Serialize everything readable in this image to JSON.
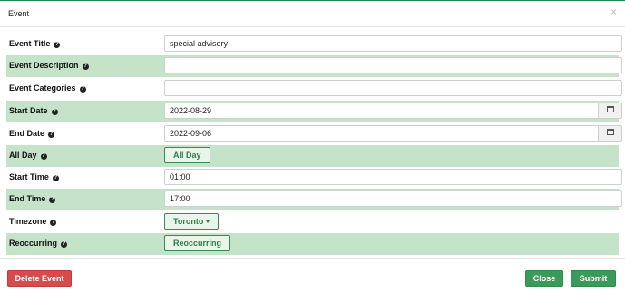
{
  "dialog": {
    "title": "Event",
    "close_symbol": "×"
  },
  "fields": {
    "title": {
      "label": "Event Title",
      "value": "special advisory"
    },
    "description": {
      "label": "Event Description",
      "value": ""
    },
    "categories": {
      "label": "Event Categories",
      "value": ""
    },
    "start_date": {
      "label": "Start Date",
      "value": "2022-08-29",
      "icon": "calendar-icon"
    },
    "end_date": {
      "label": "End Date",
      "value": "2022-09-06",
      "icon": "calendar-icon"
    },
    "all_day": {
      "label": "All Day",
      "button_label": "All Day"
    },
    "start_time": {
      "label": "Start Time",
      "value": "01:00"
    },
    "end_time": {
      "label": "End Time",
      "value": "17:00"
    },
    "timezone": {
      "label": "Timezone",
      "button_label": "Toronto"
    },
    "reoccurring": {
      "label": "Reoccurring",
      "button_label": "Reoccurring"
    }
  },
  "help_glyph": "?",
  "footer": {
    "delete_label": "Delete Event",
    "close_label": "Close",
    "submit_label": "Submit"
  },
  "colors": {
    "row_highlight": "#c4e3c8",
    "primary_green": "#3a9a5a",
    "danger_red": "#d64c4c",
    "accent_strip": "#1e8a4a"
  }
}
